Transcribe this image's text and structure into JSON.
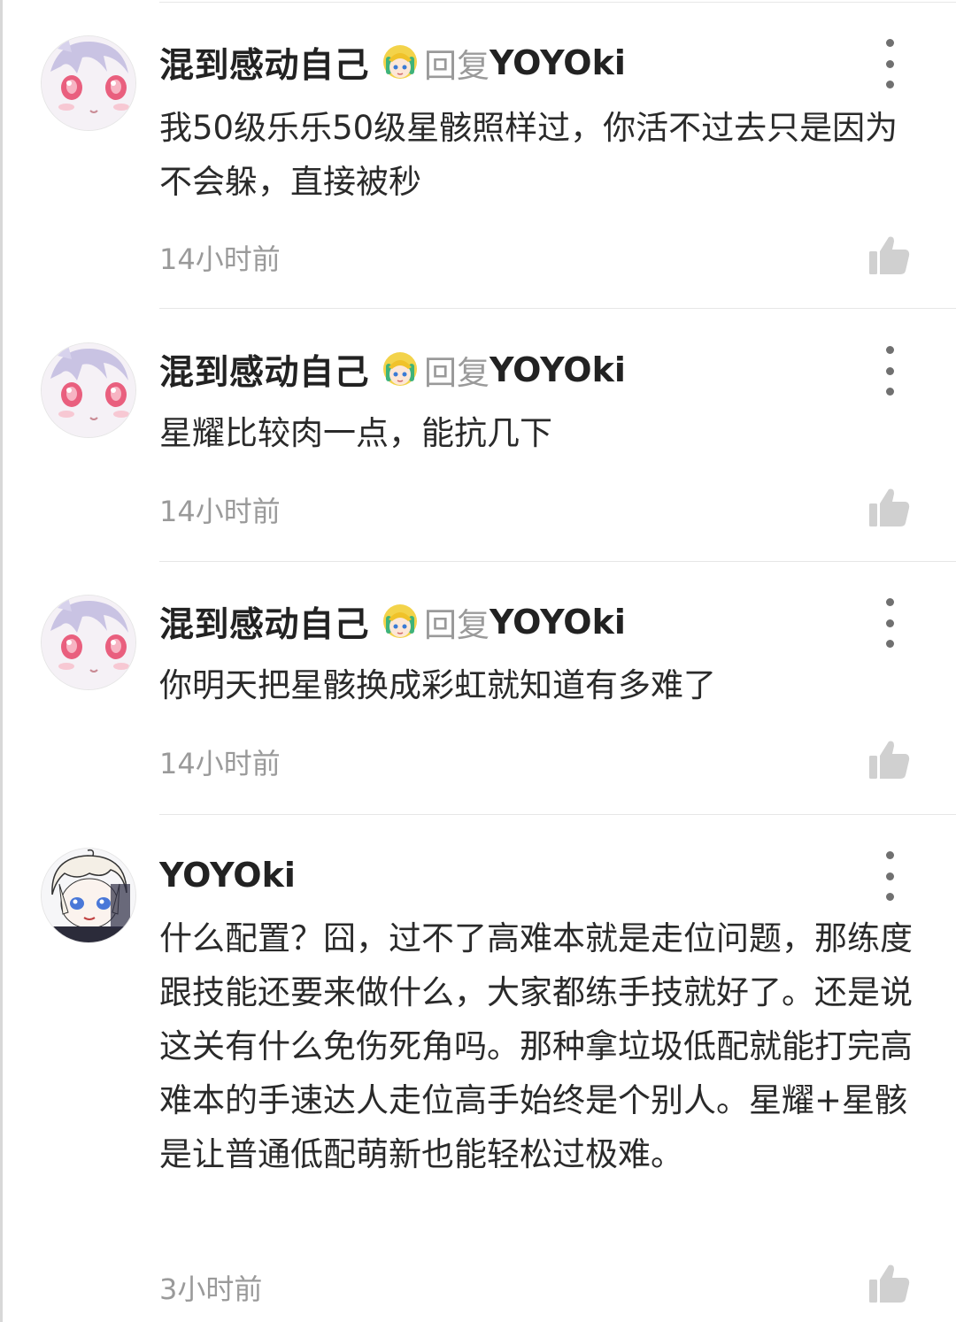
{
  "comments": [
    {
      "username": "混到感动自己",
      "reply_word": "回复",
      "reply_target": "YOYOki",
      "text": "我50级乐乐50级星骸照样过，你活不过去只是因为不会躲，直接被秒",
      "time": "14小时前",
      "avatar_icon": "anime-girl-avatar",
      "badge_icon": "blonde-chibi-badge-icon"
    },
    {
      "username": "混到感动自己",
      "reply_word": "回复",
      "reply_target": "YOYOki",
      "text": "星耀比较肉一点，能抗几下",
      "time": "14小时前",
      "avatar_icon": "anime-girl-avatar",
      "badge_icon": "blonde-chibi-badge-icon"
    },
    {
      "username": "混到感动自己",
      "reply_word": "回复",
      "reply_target": "YOYOki",
      "text": "你明天把星骸换成彩虹就知道有多难了",
      "time": "14小时前",
      "avatar_icon": "anime-girl-avatar",
      "badge_icon": "blonde-chibi-badge-icon"
    },
    {
      "username": "YOYOki",
      "text": "什么配置？囧，过不了高难本就是走位问题，那练度跟技能还要来做什么，大家都练手技就好了。还是说这关有什么免伤死角吗。那种拿垃圾低配就能打完高难本的手速达人走位高手始终是个别人。星耀+星骸是让普通低配萌新也能轻松过极难。",
      "time": "3小时前",
      "avatar_icon": "white-hair-boy-avatar"
    }
  ],
  "icons": {
    "more": "more-vertical-icon",
    "like": "thumbs-up-icon"
  },
  "colors": {
    "text": "#2a2a2a",
    "muted": "#9a9a9a",
    "icon": "#d0d0d0",
    "divider": "#e6e6e6"
  }
}
